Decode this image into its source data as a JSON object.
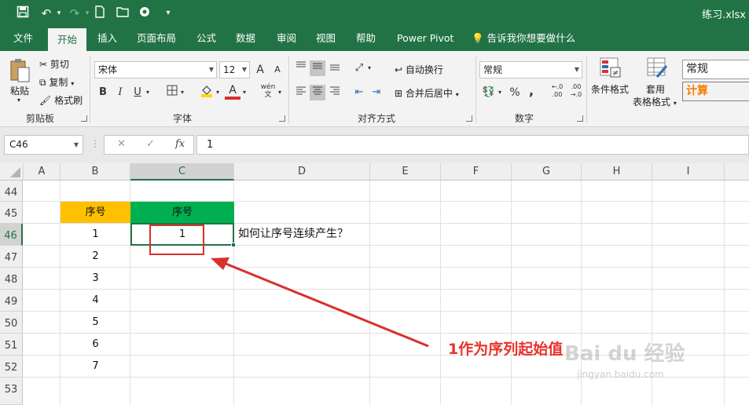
{
  "quick_access": {
    "save_icon": "save-icon",
    "undo_icon": "undo-icon",
    "redo_icon": "redo-icon",
    "new_icon": "new-file-icon",
    "open_icon": "open-folder-icon",
    "touch_icon": "touch-mode-icon",
    "customize_icon": "chevron-down-icon"
  },
  "window_title": "练习.xlsx",
  "tabs": [
    "文件",
    "开始",
    "插入",
    "页面布局",
    "公式",
    "数据",
    "审阅",
    "视图",
    "帮助",
    "Power Pivot",
    "告诉我你想要做什么"
  ],
  "active_tab": "开始",
  "ribbon": {
    "clipboard": {
      "paste": "粘贴",
      "cut": "剪切",
      "copy": "复制",
      "format_painter": "格式刷",
      "label": "剪贴板"
    },
    "font": {
      "name": "宋体",
      "size": "12",
      "grow": "A",
      "shrink": "A",
      "bold": "B",
      "italic": "I",
      "underline": "U",
      "label": "字体",
      "font_color": "#d6312f",
      "fill_color": "#ffd700",
      "phonetic": "wén"
    },
    "alignment": {
      "wrap": "自动换行",
      "merge": "合并后居中",
      "label": "对齐方式"
    },
    "number": {
      "format": "常规",
      "percent": "%",
      "comma": ",",
      "inc_decimal": "←.0 .00",
      "dec_decimal": ".00 →.0",
      "label": "数字"
    },
    "styles": {
      "conditional": "条件格式",
      "table_line1": "套用",
      "table_line2": "表格格式",
      "normal": "常规",
      "calc": "计算"
    }
  },
  "formula_bar": {
    "name_box": "C46",
    "cancel": "✕",
    "enter": "✓",
    "fx": "fx",
    "value": "1"
  },
  "columns": [
    "A",
    "B",
    "C",
    "D",
    "E",
    "F",
    "G",
    "H",
    "I"
  ],
  "selected_column": "C",
  "rows": [
    "44",
    "45",
    "46",
    "47",
    "48",
    "49",
    "50",
    "51",
    "52",
    "53"
  ],
  "selected_row": "46",
  "cells": {
    "B45": "序号",
    "C45": "序号",
    "B46": "1",
    "C46": "1",
    "D46": "如何让序号连续产生？",
    "B47": "2",
    "B48": "3",
    "B49": "4",
    "B50": "5",
    "B51": "6",
    "B52": "7"
  },
  "colors": {
    "excel_green": "#217346",
    "header_yellow": "#ffc000",
    "header_green": "#00b050",
    "annotation_red": "#e8322b"
  },
  "annotation": "1作为序列起始值",
  "watermark": {
    "brand": "Bai du 经验",
    "url": "jingyan.baidu.com"
  }
}
